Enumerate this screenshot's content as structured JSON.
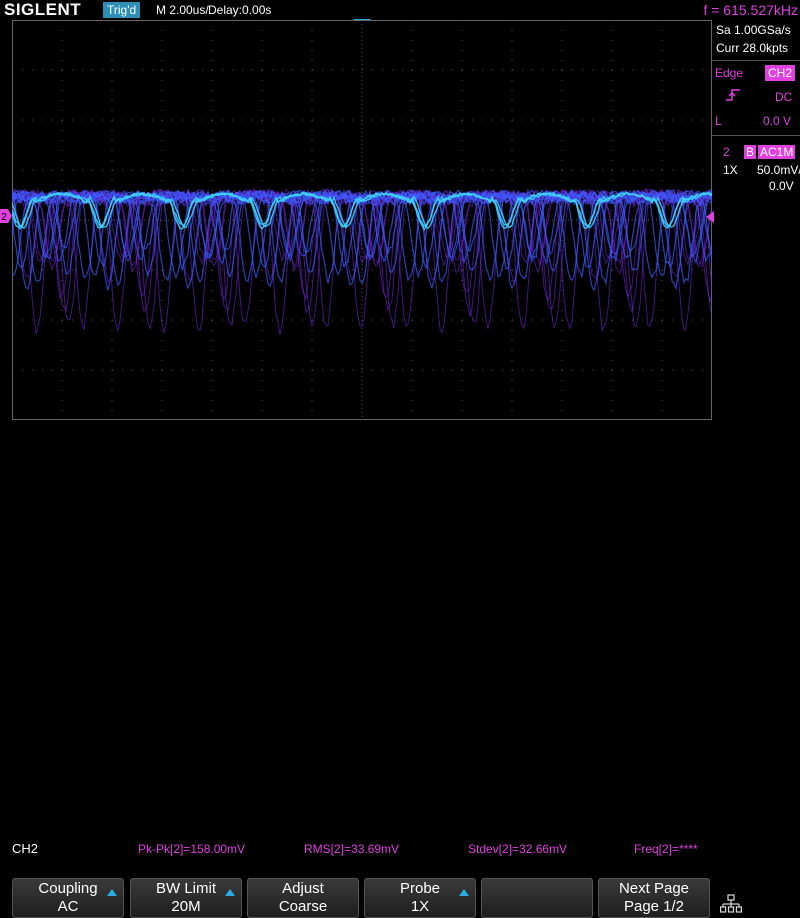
{
  "header": {
    "brand": "SIGLENT",
    "trigger_status": "Trig'd",
    "timebase": "M 2.00us/",
    "delay": "Delay:0.00s",
    "frequency": "f = 615.527kHz"
  },
  "acquisition": {
    "sample_rate": "Sa 1.00GSa/s",
    "memory": "Curr 28.0kpts"
  },
  "trigger": {
    "type": "Edge",
    "source": "CH2",
    "slope_icon": "rising-edge-icon",
    "coupling": "DC",
    "level_label": "L",
    "level_value": "0.0 V"
  },
  "channel": {
    "number": "2",
    "bw_flag": "B",
    "coupling": "AC1M",
    "probe": "1X",
    "volts_div": "50.0mV/",
    "offset": "0.0V",
    "marker": "2"
  },
  "measurements": {
    "channel": "CH2",
    "items": [
      "Pk-Pk[2]=158.00mV",
      "RMS[2]=33.69mV",
      "Stdev[2]=32.66mV",
      "Freq[2]=****"
    ]
  },
  "softkeys": [
    {
      "line1": "Coupling",
      "line2": "AC",
      "arrow": true
    },
    {
      "line1": "BW Limit",
      "line2": "20M",
      "arrow": true
    },
    {
      "line1": "Adjust",
      "line2": "Coarse",
      "arrow": false
    },
    {
      "line1": "Probe",
      "line2": "1X",
      "arrow": true
    },
    {
      "line1": "",
      "line2": "",
      "arrow": false
    },
    {
      "line1": "Next Page",
      "line2": "Page 1/2",
      "arrow": false
    }
  ],
  "colors": {
    "channel2": "#e040e0",
    "trace_core": "#3fd0ff",
    "trace_mid": "#3a5cff",
    "trace_persist": "#7a28e8",
    "accent": "#2c8fb5",
    "grid": "#555555"
  }
}
